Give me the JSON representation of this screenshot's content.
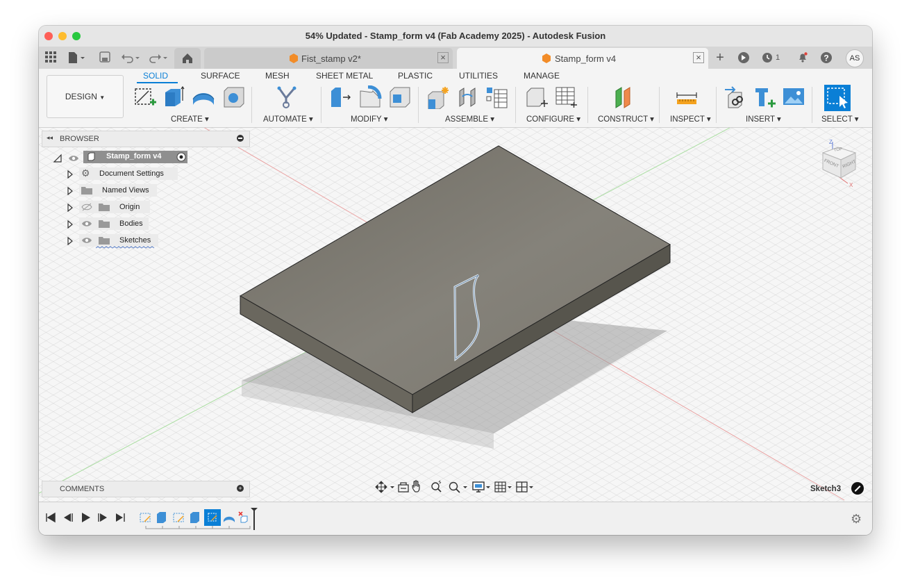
{
  "window": {
    "title": "54% Updated - Stamp_form v4 (Fab Academy 2025) - Autodesk Fusion",
    "traffic_colors": {
      "close": "#fe5f57",
      "minimize": "#febc2e",
      "maximize": "#28c840"
    }
  },
  "tabs": [
    {
      "label": "Fist_stamp v2*",
      "active": false
    },
    {
      "label": "Stamp_form v4",
      "active": true
    }
  ],
  "tabbar_right": {
    "job_count": "1",
    "user_initials": "AS"
  },
  "workspace": {
    "label": "DESIGN"
  },
  "ribbon_tabs": [
    "SOLID",
    "SURFACE",
    "MESH",
    "SHEET METAL",
    "PLASTIC",
    "UTILITIES",
    "MANAGE"
  ],
  "active_ribbon_tab": "SOLID",
  "toolbar_groups": {
    "create": "CREATE",
    "automate": "AUTOMATE",
    "modify": "MODIFY",
    "assemble": "ASSEMBLE",
    "configure": "CONFIGURE",
    "construct": "CONSTRUCT",
    "inspect": "INSPECT",
    "insert": "INSERT",
    "select": "SELECT"
  },
  "browser": {
    "title": "BROWSER",
    "root": "Stamp_form v4",
    "items": [
      {
        "label": "Document Settings",
        "icon": "gear-icon",
        "visibility": "none"
      },
      {
        "label": "Named Views",
        "icon": "folder-icon",
        "visibility": "none"
      },
      {
        "label": "Origin",
        "icon": "folder-icon",
        "visibility": "hidden"
      },
      {
        "label": "Bodies",
        "icon": "folder-icon",
        "visibility": "visible"
      },
      {
        "label": "Sketches",
        "icon": "folder-icon",
        "visibility": "visible"
      }
    ]
  },
  "comments": {
    "title": "COMMENTS"
  },
  "viewcube": {
    "front": "FRONT",
    "right": "RIGHT",
    "top": "TOP",
    "axis_z": "Z",
    "axis_x": "X"
  },
  "status": {
    "sketch_label": "Sketch3"
  },
  "colors": {
    "accent": "#0a7fd6",
    "body_top": "#7a776e",
    "body_side": "#5e5b52",
    "grid": "#d7d7d7"
  }
}
